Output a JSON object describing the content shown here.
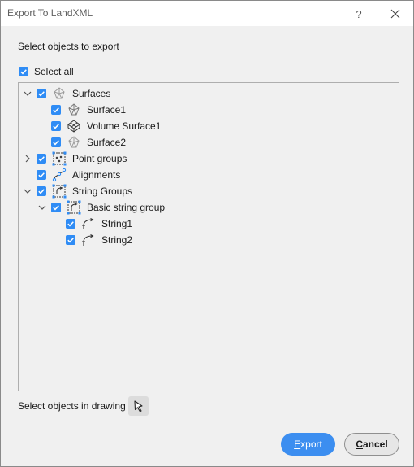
{
  "window": {
    "title": "Export To LandXML",
    "help_label": "?"
  },
  "section_label": "Select objects to export",
  "select_all": {
    "label": "Select all",
    "checked": true
  },
  "tree": [
    {
      "label": "Surfaces",
      "icon": "surfaces-icon",
      "expander": "expanded",
      "checked": true
    },
    {
      "label": "Surface1",
      "icon": "surface-icon",
      "expander": "none",
      "checked": true
    },
    {
      "label": "Volume Surface1",
      "icon": "volume-surface-icon",
      "expander": "none",
      "checked": true
    },
    {
      "label": "Surface2",
      "icon": "surface-icon",
      "expander": "none",
      "checked": true
    },
    {
      "label": "Point groups",
      "icon": "point-group-icon",
      "expander": "collapsed",
      "checked": true
    },
    {
      "label": "Alignments",
      "icon": "alignment-icon",
      "expander": "none",
      "checked": true
    },
    {
      "label": "String Groups",
      "icon": "string-group-icon",
      "expander": "expanded",
      "checked": true
    },
    {
      "label": "Basic string group",
      "icon": "string-group-icon",
      "expander": "expanded",
      "checked": true
    },
    {
      "label": "String1",
      "icon": "string-icon",
      "expander": "none",
      "checked": true
    },
    {
      "label": "String2",
      "icon": "string-icon",
      "expander": "none",
      "checked": true
    }
  ],
  "drawing_label": "Select objects in drawing",
  "buttons": {
    "export": {
      "mnemonic": "E",
      "rest": "xport"
    },
    "cancel": {
      "mnemonic": "C",
      "rest": "ancel"
    }
  },
  "colors": {
    "accent": "#2f8cf5",
    "export_button": "#3c8ef0"
  }
}
